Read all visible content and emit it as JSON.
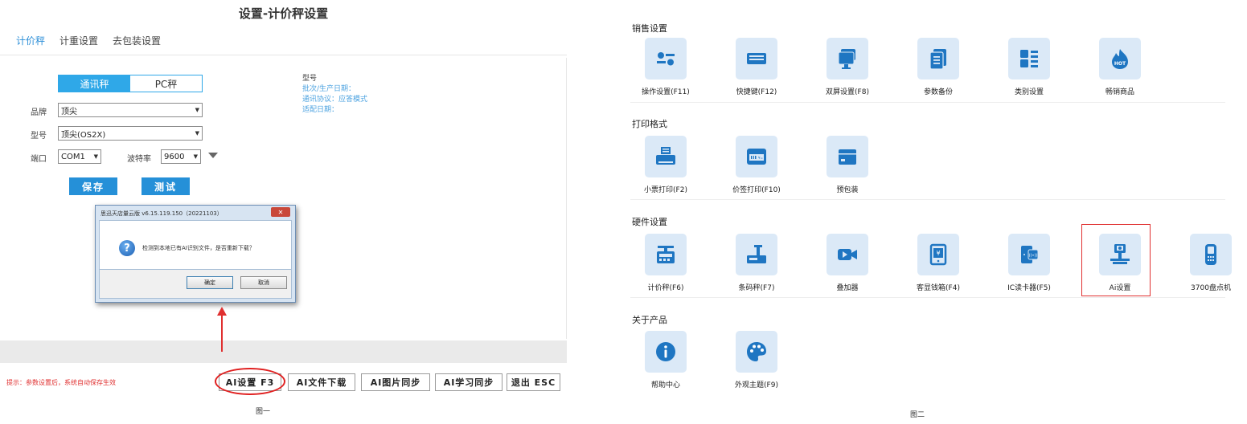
{
  "left": {
    "title": "设置-计价秤设置",
    "tabs": [
      "计价秤",
      "计重设置",
      "去包装设置"
    ],
    "segment": {
      "on": "通讯秤",
      "off": "PC秤"
    },
    "form": {
      "brand_label": "品牌",
      "brand_value": "顶尖",
      "model_label": "型号",
      "model_value": "顶尖(OS2X)",
      "port_label": "端口",
      "port_value": "COM1",
      "baud_label": "波特率",
      "baud_value": "9600"
    },
    "buttons": {
      "save": "保存",
      "test": "测试"
    },
    "info": {
      "heading": "型号",
      "batch": "批次/生产日期：",
      "protocol": "通讯协议：应答模式",
      "adapt": "适配日期："
    },
    "dialog": {
      "title": "思迅天店量云版 v6.15.119.150（20221103）",
      "message": "检测到本地已有AI识别文件，是否重新下载？",
      "ok": "确定",
      "cancel": "取消"
    },
    "hint": "提示：参数设置后，系统自动保存生效",
    "bottom_buttons": [
      "AI设置 F3",
      "AI文件下载",
      "AI图片同步",
      "AI学习同步",
      "退出 ESC"
    ],
    "caption": "图一"
  },
  "right": {
    "sections": [
      {
        "title": "销售设置",
        "items": [
          "操作设置(F11)",
          "快捷键(F12)",
          "双屏设置(F8)",
          "参数备份",
          "类别设置",
          "畅销商品"
        ]
      },
      {
        "title": "打印格式",
        "items": [
          "小票打印(F2)",
          "价签打印(F10)",
          "预包装"
        ]
      },
      {
        "title": "硬件设置",
        "items": [
          "计价秤(F6)",
          "条码秤(F7)",
          "叠加器",
          "客显钱箱(F4)",
          "IC读卡器(F5)",
          "Ai设置",
          "3700盘点机"
        ]
      },
      {
        "title": "关于产品",
        "items": [
          "帮助中心",
          "外观主题(F9)"
        ]
      }
    ],
    "caption": "图二"
  },
  "colors": {
    "accent": "#2590d8",
    "tile_bg": "#dbe9f7",
    "icon": "#1f76c2",
    "highlight": "#e03030"
  },
  "icons": [
    "settings-list-icon",
    "keyboard-icon",
    "monitor-icon",
    "document-copy-icon",
    "category-icon",
    "hot-icon",
    "receipt-printer-icon",
    "label-printer-icon",
    "package-icon",
    "price-scale-icon",
    "barcode-scale-icon",
    "video-camera-icon",
    "cash-drawer-icon",
    "card-reader-icon",
    "ai-scale-icon",
    "handheld-terminal-icon",
    "info-icon",
    "palette-icon"
  ]
}
